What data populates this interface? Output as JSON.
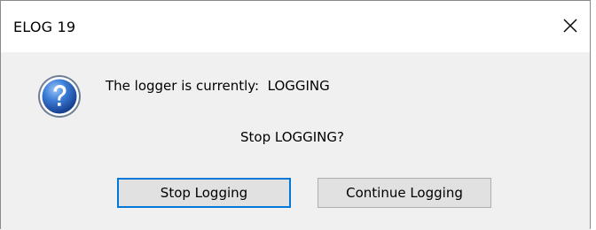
{
  "window": {
    "title": "ELOG 19"
  },
  "message": {
    "line1": "The logger is currently:  LOGGING",
    "line2": "Stop LOGGING?"
  },
  "buttons": {
    "stop_label": "Stop Logging",
    "continue_label": "Continue Logging"
  },
  "icons": {
    "close": "close-icon",
    "question": "question-icon"
  },
  "colors": {
    "icon_blue": "#1f5fbf",
    "default_button_border": "#0078d7",
    "dialog_background": "#f0f0f0"
  }
}
